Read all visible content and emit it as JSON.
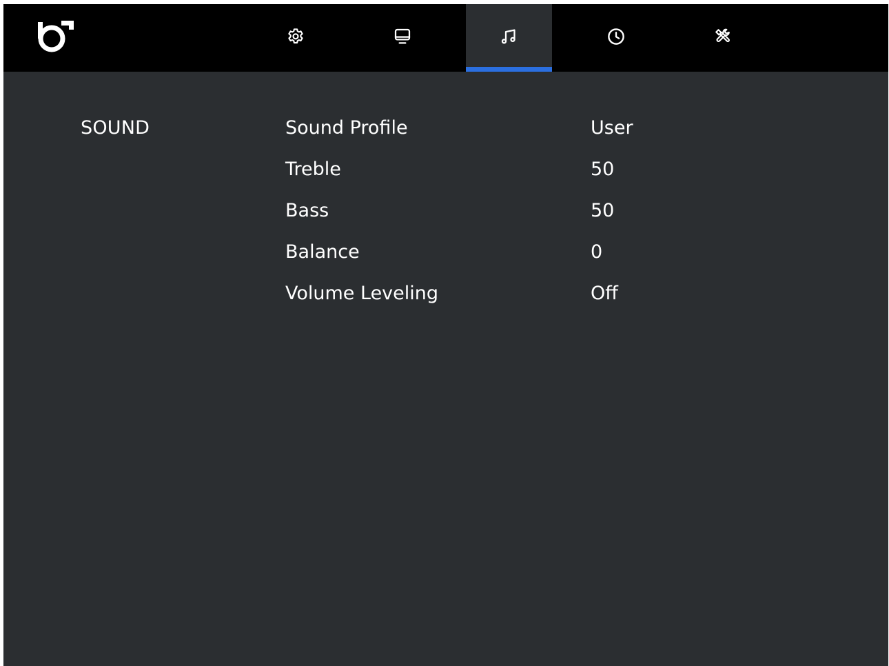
{
  "header": {
    "logo": "brand-logo",
    "tabs": [
      {
        "icon": "gear-icon",
        "active": false
      },
      {
        "icon": "monitor-icon",
        "active": false
      },
      {
        "icon": "music-note-icon",
        "active": true
      },
      {
        "icon": "clock-icon",
        "active": false
      },
      {
        "icon": "tools-icon",
        "active": false
      }
    ],
    "active_indicator_color": "#2b6fe0"
  },
  "main": {
    "section_title": "SOUND",
    "settings": [
      {
        "label": "Sound Profile",
        "value": "User"
      },
      {
        "label": "Treble",
        "value": "50"
      },
      {
        "label": "Bass",
        "value": "50"
      },
      {
        "label": "Balance",
        "value": "0"
      },
      {
        "label": "Volume Leveling",
        "value": "Off"
      }
    ]
  },
  "colors": {
    "background": "#2b2e31",
    "topbar": "#000000",
    "text": "#ffffff"
  }
}
